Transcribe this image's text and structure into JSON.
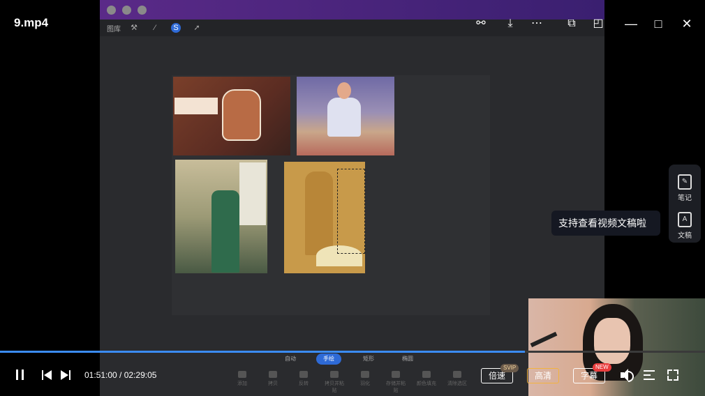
{
  "window": {
    "title": "9.mp4",
    "minimize_icon": "minimize-icon",
    "maximize_icon": "maximize-icon",
    "close_icon": "close-icon",
    "minimize_glyph": "—",
    "maximize_glyph": "□",
    "close_glyph": "✕"
  },
  "video": {
    "toolbar_label": "图库",
    "bottom_tabs": [
      {
        "label": "自动"
      },
      {
        "label": "手绘"
      },
      {
        "label": "矩形"
      },
      {
        "label": "椭圆"
      }
    ],
    "tools": [
      {
        "label": "添加"
      },
      {
        "label": "拷贝"
      },
      {
        "label": "反转"
      },
      {
        "label": "拷贝并粘贴"
      },
      {
        "label": "羽化"
      },
      {
        "label": "存储并粘贴"
      },
      {
        "label": "颜色填充"
      },
      {
        "label": "清除选区"
      }
    ]
  },
  "side_panel": {
    "notes_label": "笔记",
    "transcript_label": "文稿",
    "tooltip": "支持查看视频文稿啦"
  },
  "player": {
    "current_time": "01:51:00",
    "separator": " / ",
    "duration": "02:29:05",
    "progress": 0.745,
    "speed_label": "倍速",
    "speed_badge": "SVIP",
    "quality_label": "高清",
    "subtitle_label": "字幕",
    "subtitle_badge": "NEW"
  },
  "colors": {
    "accent": "#3b8cf5",
    "quality_border": "#f3b33d",
    "badge_new": "#e93d3d"
  }
}
